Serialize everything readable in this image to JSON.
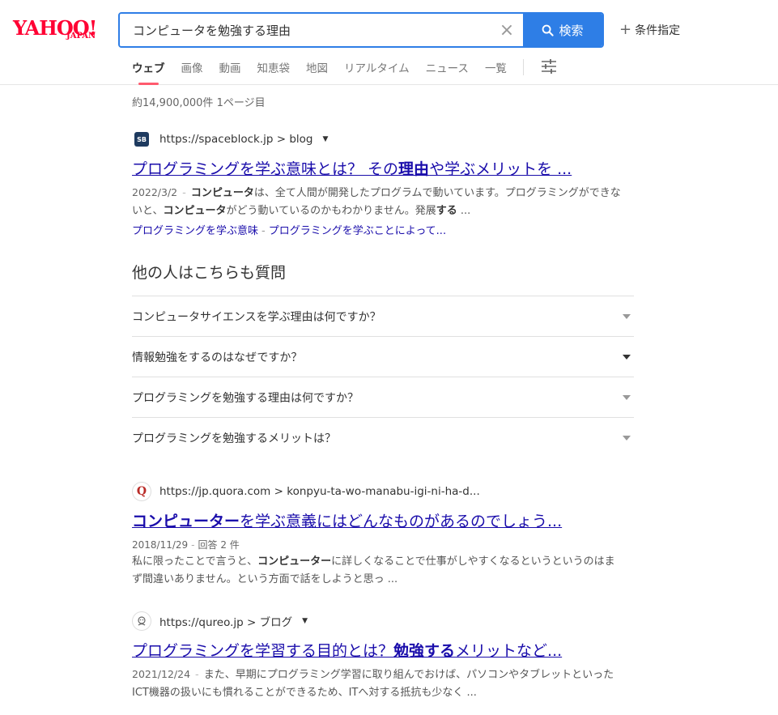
{
  "logo": {
    "main": "YAHOO!",
    "sub": "JAPAN"
  },
  "search": {
    "query": "コンピュータを勉強する理由",
    "button_label": "検索",
    "clear_symbol": "×"
  },
  "conditions": {
    "label": "条件指定",
    "plus": "+"
  },
  "tabs": [
    {
      "label": "ウェブ",
      "active": true
    },
    {
      "label": "画像"
    },
    {
      "label": "動画"
    },
    {
      "label": "知恵袋"
    },
    {
      "label": "地図"
    },
    {
      "label": "リアルタイム"
    },
    {
      "label": "ニュース"
    },
    {
      "label": "一覧"
    }
  ],
  "result_count": "約14,900,000件  1ページ目",
  "results": [
    {
      "favicon_text": "SB",
      "url": "https://spaceblock.jp > blog",
      "title_parts": [
        "プログラミングを学ぶ意味とは？ その",
        "理由",
        "や学ぶメリットを ..."
      ],
      "date": "2022/3/2",
      "snippet_parts": [
        "コンピュータ",
        "は、全て人間が開発したプログラムで動いています。プログラミングができないと、",
        "コンピュータ",
        "がどう動いているのかもわかりません。発展",
        "する",
        " ..."
      ],
      "sub_links": [
        "プログラミングを学ぶ意味",
        "プログラミングを学ぶことによって..."
      ]
    },
    {
      "favicon_text": "Q",
      "url": "https://jp.quora.com > konpyu-ta-wo-manabu-igi-ni-ha-d...",
      "title_parts": [
        "コンピューター",
        "を学ぶ意義にはどんなものがあるのでしょう..."
      ],
      "date": "2018/11/29",
      "extra_meta": "回答 2 件",
      "snippet_parts": [
        "私に限ったことで言うと、",
        "コンピューター",
        "に詳しくなることで仕事がしやすくなるというというのはまず間違いありません。という方面で話をしようと思っ ..."
      ]
    },
    {
      "favicon_text": "",
      "url": "https://qureo.jp > ブログ",
      "title_parts": [
        "プログラミングを学習する目的とは？",
        "勉強する",
        "メリットなど..."
      ],
      "date": "2021/12/24",
      "snippet_parts": [
        "また、早期にプログラミング学習に取り組んでおけば、パソコンやタブレットといったICT機器の扱いにも慣れることができるため、ITへ対する抵抗も少なく ..."
      ]
    }
  ],
  "paa": {
    "title": "他の人はこちらも質問",
    "questions": [
      "コンピュータサイエンスを学ぶ理由は何ですか？",
      "情報勉強をするのはなぜですか？",
      "プログラミングを勉強する理由は何ですか？",
      "プログラミングを勉強するメリットは？"
    ]
  }
}
